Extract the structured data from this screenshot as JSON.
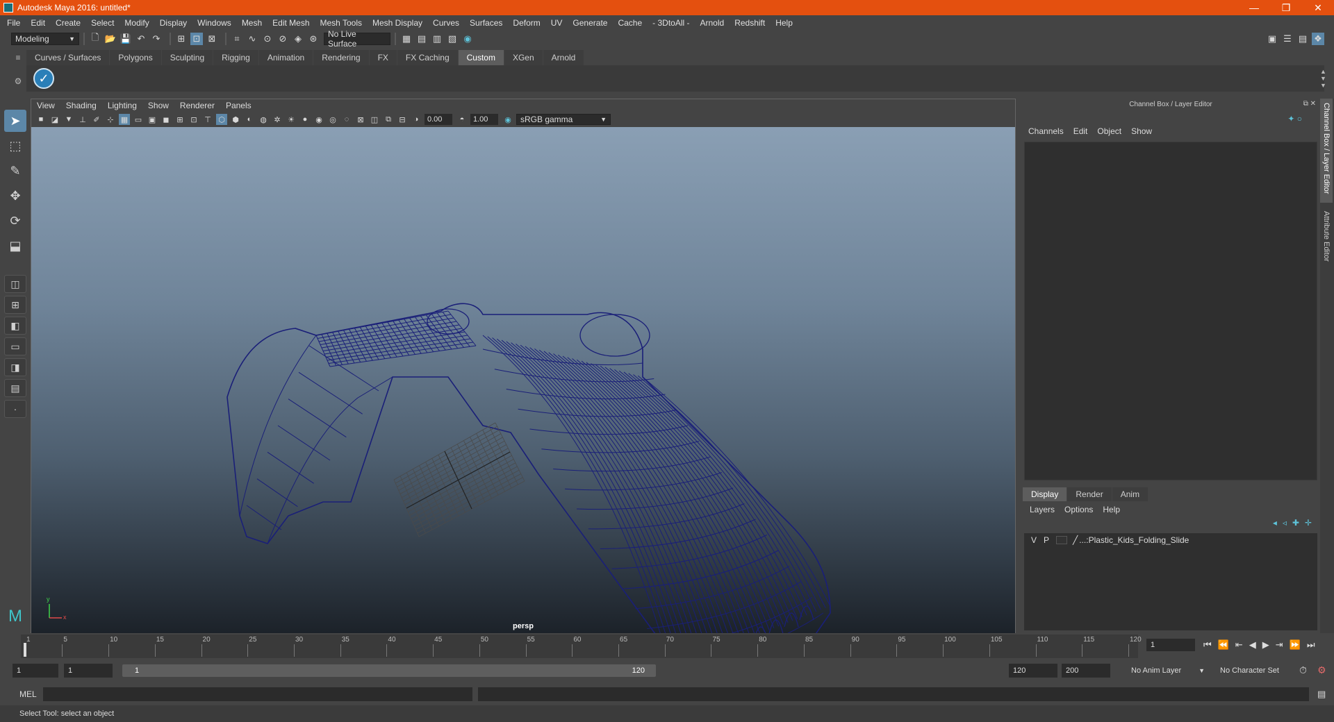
{
  "window": {
    "title": "Autodesk Maya 2016: untitled*",
    "minimize": "—",
    "maximize": "❐",
    "close": "✕"
  },
  "menubar": [
    "File",
    "Edit",
    "Create",
    "Select",
    "Modify",
    "Display",
    "Windows",
    "Mesh",
    "Edit Mesh",
    "Mesh Tools",
    "Mesh Display",
    "Curves",
    "Surfaces",
    "Deform",
    "UV",
    "Generate",
    "Cache",
    "- 3DtoAll -",
    "Arnold",
    "Redshift",
    "Help"
  ],
  "statusline": {
    "mode": "Modeling",
    "live_surface": "No Live Surface"
  },
  "shelf_tabs": [
    {
      "label": "Curves / Surfaces",
      "active": false
    },
    {
      "label": "Polygons",
      "active": false
    },
    {
      "label": "Sculpting",
      "active": false
    },
    {
      "label": "Rigging",
      "active": false
    },
    {
      "label": "Animation",
      "active": false
    },
    {
      "label": "Rendering",
      "active": false
    },
    {
      "label": "FX",
      "active": false
    },
    {
      "label": "FX Caching",
      "active": false
    },
    {
      "label": "Custom",
      "active": true
    },
    {
      "label": "XGen",
      "active": false
    },
    {
      "label": "Arnold",
      "active": false
    }
  ],
  "viewport": {
    "menu": [
      "View",
      "Shading",
      "Lighting",
      "Show",
      "Renderer",
      "Panels"
    ],
    "exposure": "0.00",
    "gamma": "1.00",
    "color_space": "sRGB gamma",
    "camera_label": "persp",
    "axis_y": "y",
    "axis_x": "x",
    "wire_color": "#1a1f78"
  },
  "channel_box": {
    "title": "Channel Box / Layer Editor",
    "menu": [
      "Channels",
      "Edit",
      "Object",
      "Show"
    ]
  },
  "layer_editor": {
    "tabs": [
      {
        "label": "Display",
        "active": true
      },
      {
        "label": "Render",
        "active": false
      },
      {
        "label": "Anim",
        "active": false
      }
    ],
    "menu": [
      "Layers",
      "Options",
      "Help"
    ],
    "layer": {
      "v": "V",
      "p": "P",
      "name": "...:Plastic_Kids_Folding_Slide"
    }
  },
  "side_tabs": [
    "Channel Box / Layer Editor",
    "Attribute Editor"
  ],
  "timeslider": {
    "labels": [
      "1",
      "5",
      "10",
      "15",
      "20",
      "25",
      "30",
      "35",
      "40",
      "45",
      "50",
      "55",
      "60",
      "65",
      "70",
      "75",
      "80",
      "85",
      "90",
      "95",
      "100",
      "105",
      "110",
      "115",
      "120"
    ],
    "current_frame": "1"
  },
  "range": {
    "start": "1",
    "anim_start": "1",
    "slider_start": "1",
    "slider_end": "120",
    "anim_end": "120",
    "end": "200",
    "anim_layer": "No Anim Layer",
    "character_set": "No Character Set"
  },
  "cmdline": {
    "label": "MEL"
  },
  "status": {
    "message": "Select Tool: select an object"
  }
}
